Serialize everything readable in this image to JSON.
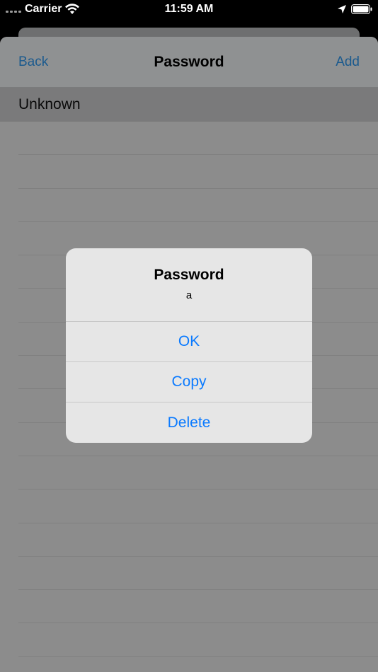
{
  "status_bar": {
    "carrier": "Carrier",
    "time": "11:59 AM"
  },
  "navbar": {
    "back_label": "Back",
    "title": "Password",
    "add_label": "Add"
  },
  "section": {
    "header": "Unknown"
  },
  "alert": {
    "title": "Password",
    "message": "a",
    "buttons": {
      "ok": "OK",
      "copy": "Copy",
      "delete": "Delete"
    }
  },
  "colors": {
    "accent": "#0a7aff",
    "dimmed_accent": "#1b5a8e"
  }
}
